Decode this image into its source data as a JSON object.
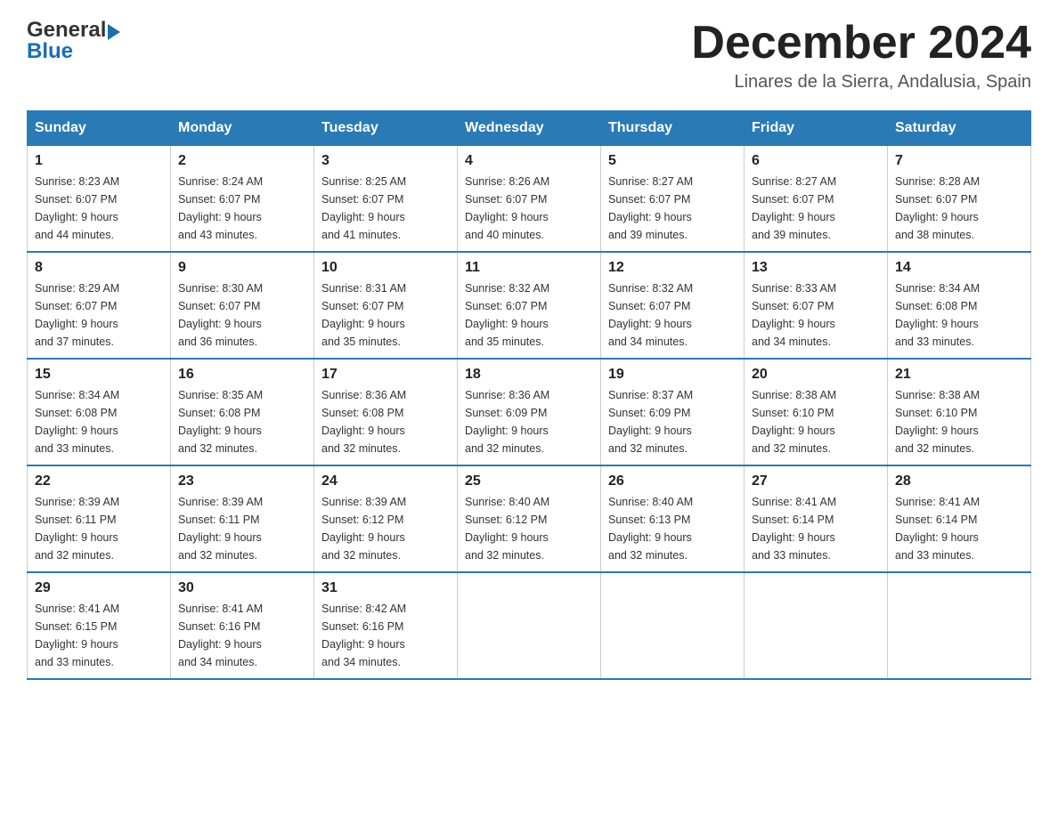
{
  "header": {
    "logo_general": "General",
    "logo_blue": "Blue",
    "month_title": "December 2024",
    "location": "Linares de la Sierra, Andalusia, Spain"
  },
  "days_of_week": [
    "Sunday",
    "Monday",
    "Tuesday",
    "Wednesday",
    "Thursday",
    "Friday",
    "Saturday"
  ],
  "weeks": [
    [
      {
        "day": "1",
        "sunrise": "8:23 AM",
        "sunset": "6:07 PM",
        "daylight": "9 hours and 44 minutes."
      },
      {
        "day": "2",
        "sunrise": "8:24 AM",
        "sunset": "6:07 PM",
        "daylight": "9 hours and 43 minutes."
      },
      {
        "day": "3",
        "sunrise": "8:25 AM",
        "sunset": "6:07 PM",
        "daylight": "9 hours and 41 minutes."
      },
      {
        "day": "4",
        "sunrise": "8:26 AM",
        "sunset": "6:07 PM",
        "daylight": "9 hours and 40 minutes."
      },
      {
        "day": "5",
        "sunrise": "8:27 AM",
        "sunset": "6:07 PM",
        "daylight": "9 hours and 39 minutes."
      },
      {
        "day": "6",
        "sunrise": "8:27 AM",
        "sunset": "6:07 PM",
        "daylight": "9 hours and 39 minutes."
      },
      {
        "day": "7",
        "sunrise": "8:28 AM",
        "sunset": "6:07 PM",
        "daylight": "9 hours and 38 minutes."
      }
    ],
    [
      {
        "day": "8",
        "sunrise": "8:29 AM",
        "sunset": "6:07 PM",
        "daylight": "9 hours and 37 minutes."
      },
      {
        "day": "9",
        "sunrise": "8:30 AM",
        "sunset": "6:07 PM",
        "daylight": "9 hours and 36 minutes."
      },
      {
        "day": "10",
        "sunrise": "8:31 AM",
        "sunset": "6:07 PM",
        "daylight": "9 hours and 35 minutes."
      },
      {
        "day": "11",
        "sunrise": "8:32 AM",
        "sunset": "6:07 PM",
        "daylight": "9 hours and 35 minutes."
      },
      {
        "day": "12",
        "sunrise": "8:32 AM",
        "sunset": "6:07 PM",
        "daylight": "9 hours and 34 minutes."
      },
      {
        "day": "13",
        "sunrise": "8:33 AM",
        "sunset": "6:07 PM",
        "daylight": "9 hours and 34 minutes."
      },
      {
        "day": "14",
        "sunrise": "8:34 AM",
        "sunset": "6:08 PM",
        "daylight": "9 hours and 33 minutes."
      }
    ],
    [
      {
        "day": "15",
        "sunrise": "8:34 AM",
        "sunset": "6:08 PM",
        "daylight": "9 hours and 33 minutes."
      },
      {
        "day": "16",
        "sunrise": "8:35 AM",
        "sunset": "6:08 PM",
        "daylight": "9 hours and 32 minutes."
      },
      {
        "day": "17",
        "sunrise": "8:36 AM",
        "sunset": "6:08 PM",
        "daylight": "9 hours and 32 minutes."
      },
      {
        "day": "18",
        "sunrise": "8:36 AM",
        "sunset": "6:09 PM",
        "daylight": "9 hours and 32 minutes."
      },
      {
        "day": "19",
        "sunrise": "8:37 AM",
        "sunset": "6:09 PM",
        "daylight": "9 hours and 32 minutes."
      },
      {
        "day": "20",
        "sunrise": "8:38 AM",
        "sunset": "6:10 PM",
        "daylight": "9 hours and 32 minutes."
      },
      {
        "day": "21",
        "sunrise": "8:38 AM",
        "sunset": "6:10 PM",
        "daylight": "9 hours and 32 minutes."
      }
    ],
    [
      {
        "day": "22",
        "sunrise": "8:39 AM",
        "sunset": "6:11 PM",
        "daylight": "9 hours and 32 minutes."
      },
      {
        "day": "23",
        "sunrise": "8:39 AM",
        "sunset": "6:11 PM",
        "daylight": "9 hours and 32 minutes."
      },
      {
        "day": "24",
        "sunrise": "8:39 AM",
        "sunset": "6:12 PM",
        "daylight": "9 hours and 32 minutes."
      },
      {
        "day": "25",
        "sunrise": "8:40 AM",
        "sunset": "6:12 PM",
        "daylight": "9 hours and 32 minutes."
      },
      {
        "day": "26",
        "sunrise": "8:40 AM",
        "sunset": "6:13 PM",
        "daylight": "9 hours and 32 minutes."
      },
      {
        "day": "27",
        "sunrise": "8:41 AM",
        "sunset": "6:14 PM",
        "daylight": "9 hours and 33 minutes."
      },
      {
        "day": "28",
        "sunrise": "8:41 AM",
        "sunset": "6:14 PM",
        "daylight": "9 hours and 33 minutes."
      }
    ],
    [
      {
        "day": "29",
        "sunrise": "8:41 AM",
        "sunset": "6:15 PM",
        "daylight": "9 hours and 33 minutes."
      },
      {
        "day": "30",
        "sunrise": "8:41 AM",
        "sunset": "6:16 PM",
        "daylight": "9 hours and 34 minutes."
      },
      {
        "day": "31",
        "sunrise": "8:42 AM",
        "sunset": "6:16 PM",
        "daylight": "9 hours and 34 minutes."
      },
      null,
      null,
      null,
      null
    ]
  ],
  "labels": {
    "sunrise": "Sunrise:",
    "sunset": "Sunset:",
    "daylight": "Daylight:"
  }
}
